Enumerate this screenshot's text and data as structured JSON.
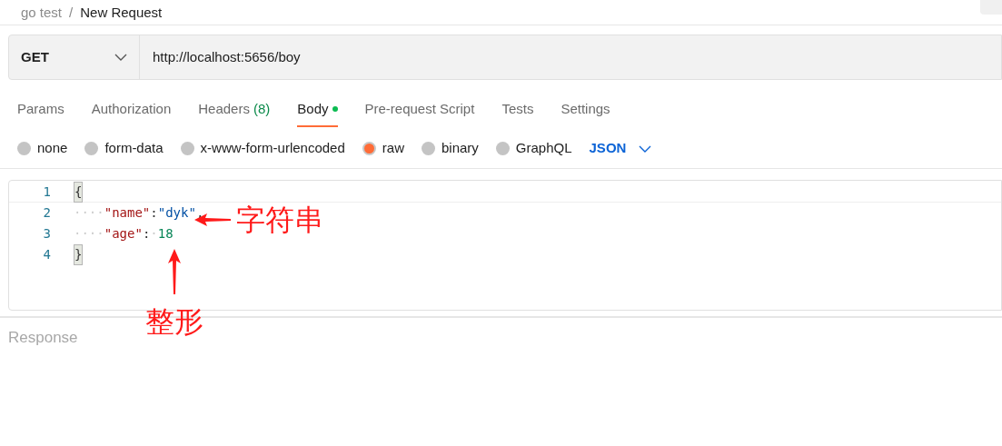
{
  "breadcrumb": {
    "collection": "go test",
    "separator": "/",
    "request": "New Request"
  },
  "request": {
    "method": "GET",
    "url": "http://localhost:5656/boy"
  },
  "tabs": [
    {
      "label": "Params",
      "selected": false
    },
    {
      "label": "Authorization",
      "selected": false
    },
    {
      "label": "Headers",
      "count": "(8)",
      "selected": false
    },
    {
      "label": "Body",
      "selected": true,
      "dot": true
    },
    {
      "label": "Pre-request Script",
      "selected": false
    },
    {
      "label": "Tests",
      "selected": false
    },
    {
      "label": "Settings",
      "selected": false
    }
  ],
  "body_types": [
    {
      "label": "none",
      "selected": false
    },
    {
      "label": "form-data",
      "selected": false
    },
    {
      "label": "x-www-form-urlencoded",
      "selected": false
    },
    {
      "label": "raw",
      "selected": true
    },
    {
      "label": "binary",
      "selected": false
    },
    {
      "label": "GraphQL",
      "selected": false
    }
  ],
  "format": "JSON",
  "editor": {
    "lines": [
      {
        "number": "1",
        "tokens": [
          {
            "kind": "bracket",
            "text": "{"
          }
        ]
      },
      {
        "number": "2",
        "tokens": [
          {
            "kind": "space",
            "text": "····"
          },
          {
            "kind": "key",
            "text": "\"name\""
          },
          {
            "kind": "punct",
            "text": ":"
          },
          {
            "kind": "string",
            "text": "\"dyk\""
          },
          {
            "kind": "punct",
            "text": ","
          }
        ]
      },
      {
        "number": "3",
        "tokens": [
          {
            "kind": "space",
            "text": "····"
          },
          {
            "kind": "key",
            "text": "\"age\""
          },
          {
            "kind": "punct",
            "text": ":"
          },
          {
            "kind": "space",
            "text": "·"
          },
          {
            "kind": "number",
            "text": "18"
          }
        ]
      },
      {
        "number": "4",
        "tokens": [
          {
            "kind": "bracket",
            "text": "}"
          }
        ]
      }
    ]
  },
  "annotations": [
    {
      "kind": "left",
      "text": "字符串"
    },
    {
      "kind": "up",
      "text": "整形"
    }
  ],
  "response": {
    "title": "Response"
  }
}
